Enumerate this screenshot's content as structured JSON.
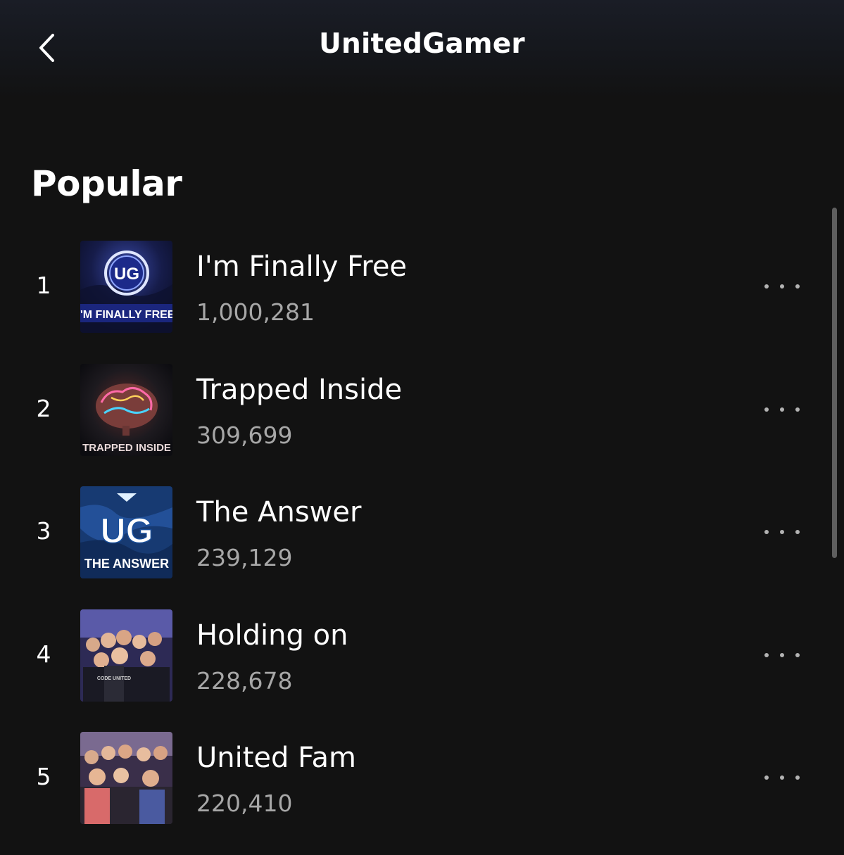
{
  "header": {
    "title": "UnitedGamer",
    "back_icon": "chevron-left-icon"
  },
  "section": {
    "title": "Popular"
  },
  "tracks": [
    {
      "rank": "1",
      "title": "I'm Finally Free",
      "plays": "1,000,281",
      "cover_label": "I'M FINALLY FREE",
      "cover_logo": "UG"
    },
    {
      "rank": "2",
      "title": "Trapped Inside",
      "plays": "309,699",
      "cover_label": "TRAPPED INSIDE"
    },
    {
      "rank": "3",
      "title": "The Answer",
      "plays": "239,129",
      "cover_label": "THE ANSWER",
      "cover_logo": "UG"
    },
    {
      "rank": "4",
      "title": "Holding on",
      "plays": "228,678",
      "cover_label": "CODE UNITED"
    },
    {
      "rank": "5",
      "title": "United Fam",
      "plays": "220,410"
    }
  ],
  "colors": {
    "background": "#121212",
    "primary_text": "#ffffff",
    "secondary_text": "#a7a7a7",
    "more_dots": "#b3b3b3",
    "scrollbar": "#5e5e5e"
  }
}
